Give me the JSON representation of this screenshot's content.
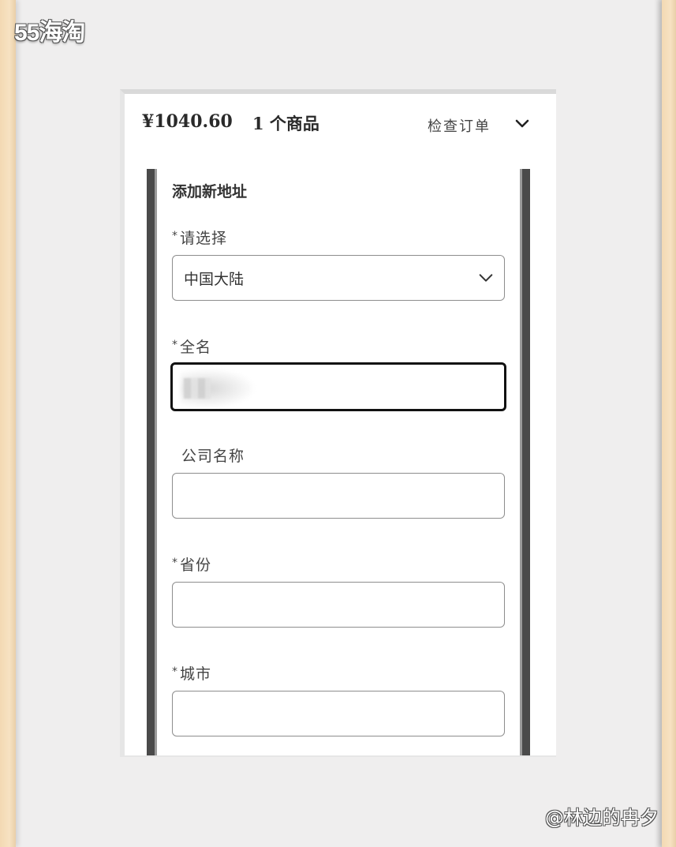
{
  "logo": "55海淘",
  "watermark": "@林边的冉夕",
  "summary": {
    "price": "¥1040.60",
    "count": "1 个商品",
    "review_label": "检查订单",
    "review_icon": "chevron-down-icon"
  },
  "form": {
    "title": "添加新地址",
    "required_mark": "*",
    "fields": [
      {
        "label": "请选择",
        "required": true,
        "value": "中国大陆",
        "type": "select"
      },
      {
        "label": "全名",
        "required": true,
        "value": "",
        "type": "text",
        "focused": true
      },
      {
        "label": "公司名称",
        "required": false,
        "value": "",
        "type": "text"
      },
      {
        "label": "省份",
        "required": true,
        "value": "",
        "type": "text"
      },
      {
        "label": "城市",
        "required": true,
        "value": "",
        "type": "text"
      }
    ]
  }
}
